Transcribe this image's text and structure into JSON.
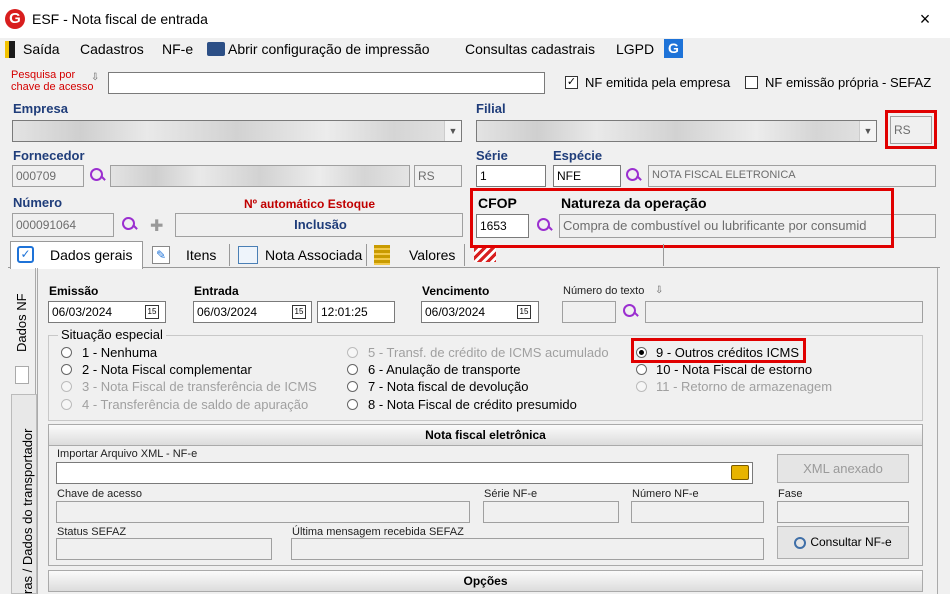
{
  "window": {
    "title": "ESF - Nota fiscal de entrada",
    "close": "×",
    "logo": "G"
  },
  "menu": {
    "saida": "Saída",
    "cadastros": "Cadastros",
    "nfe": "NF-e",
    "abrir_config": "Abrir configuração de impressão",
    "consultas": "Consultas cadastrais",
    "lgpd": "LGPD",
    "lgpd_icon": "G"
  },
  "search": {
    "label_line1": "Pesquisa por",
    "label_line2": "chave de acesso",
    "value": ""
  },
  "checks": {
    "nf_emitida_label": "NF emitida pela empresa",
    "nf_emitida_checked": true,
    "nf_propria_label": "NF emissão própria - SEFAZ",
    "nf_propria_checked": false
  },
  "empresa": {
    "label": "Empresa"
  },
  "filial": {
    "label": "Filial",
    "uf": "RS"
  },
  "fornecedor": {
    "label": "Fornecedor",
    "code": "000709",
    "uf": "RS"
  },
  "serie": {
    "label": "Série",
    "value": "1"
  },
  "especie": {
    "label": "Espécie",
    "code": "NFE",
    "desc": "NOTA FISCAL ELETRONICA"
  },
  "numero": {
    "label": "Número",
    "value": "000091064"
  },
  "auto_estoque": {
    "label": "Nº automático Estoque",
    "mode": "Inclusão"
  },
  "cfop": {
    "label": "CFOP",
    "value": "1653"
  },
  "natureza": {
    "label": "Natureza da operação",
    "value": "Compra de combustível ou lubrificante por consumid"
  },
  "tabs": {
    "dados_gerais": "Dados gerais",
    "itens": "Itens",
    "nota_associada": "Nota Associada",
    "valores": "Valores"
  },
  "side_tabs": {
    "dados_nf": "Dados NF",
    "transportador": "ras  /  Dados do transportador"
  },
  "dates": {
    "emissao_label": "Emissão",
    "emissao": "06/03/2024",
    "entrada_label": "Entrada",
    "entrada": "06/03/2024",
    "hora": "12:01:25",
    "vencimento_label": "Vencimento",
    "vencimento": "06/03/2024",
    "numero_texto_label": "Número do texto",
    "cal_icon": "15"
  },
  "situacao": {
    "legend": "Situação especial",
    "opt1": "1 - Nenhuma",
    "opt2": "2 - Nota Fiscal complementar",
    "opt3": "3 - Nota Fiscal de transferência de ICMS",
    "opt4": "4 - Transferência de saldo de apuração",
    "opt5": "5 - Transf. de crédito de ICMS acumulado",
    "opt6": "6 - Anulação de transporte",
    "opt7": "7 - Nota fiscal de devolução",
    "opt8": "8 - Nota Fiscal de crédito presumido",
    "opt9": "9 - Outros créditos ICMS",
    "opt10": "10 - Nota Fiscal de estorno",
    "opt11": "11 - Retorno de armazenagem",
    "selected": "9"
  },
  "nfe": {
    "header": "Nota fiscal eletrônica",
    "importar_label": "Importar Arquivo XML - NF-e",
    "xml_btn": "XML anexado",
    "chave_label": "Chave de acesso",
    "serie_label": "Série NF-e",
    "numero_label": "Número NF-e",
    "fase_label": "Fase",
    "status_label": "Status SEFAZ",
    "ultima_label": "Última mensagem recebida SEFAZ",
    "consultar_btn": "Consultar NF-e"
  },
  "opcoes": {
    "header": "Opções"
  }
}
